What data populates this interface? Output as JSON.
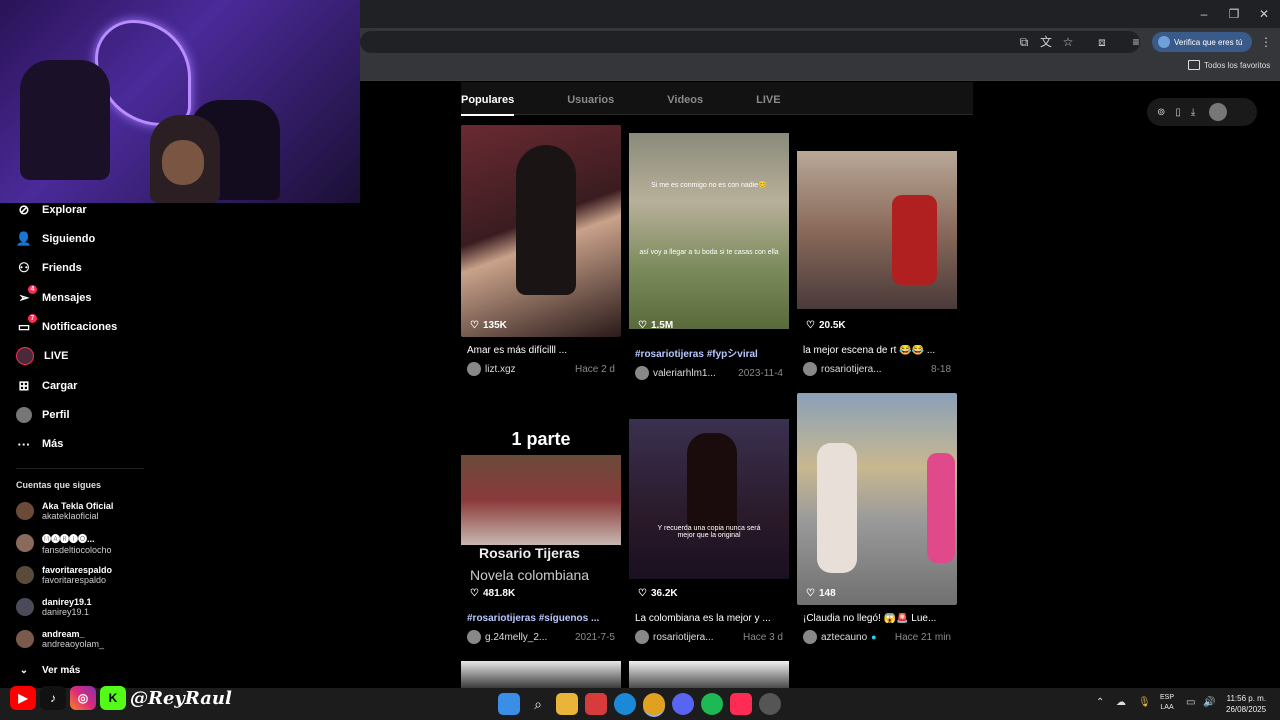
{
  "browser": {
    "verify_label": "Verifica que eres tú",
    "favorites_label": "Todos los favoritos"
  },
  "sidebar": {
    "items": [
      {
        "label": "Explorar",
        "icon": "compass-icon"
      },
      {
        "label": "Siguiendo",
        "icon": "following-icon"
      },
      {
        "label": "Friends",
        "icon": "friends-icon"
      },
      {
        "label": "Mensajes",
        "icon": "messages-icon",
        "badge": "4"
      },
      {
        "label": "Notificaciones",
        "icon": "notifications-icon",
        "badge": "7"
      },
      {
        "label": "LIVE",
        "icon": "live-icon"
      },
      {
        "label": "Cargar",
        "icon": "upload-icon"
      },
      {
        "label": "Perfil",
        "icon": "profile-icon"
      },
      {
        "label": "Más",
        "icon": "more-icon"
      }
    ],
    "following_title": "Cuentas que sigues",
    "accounts": [
      {
        "name": "Aka Tekla Oficial",
        "handle": "akateklaoficial"
      },
      {
        "name": "🅜🅐🅡🅘🅞...",
        "handle": "fansdeltiocolocho"
      },
      {
        "name": "favoritarespaldo",
        "handle": "favoritarespaldo"
      },
      {
        "name": "danirey19.1",
        "handle": "danirey19.1"
      },
      {
        "name": "andream_",
        "handle": "andreaoyolam_"
      }
    ],
    "see_more": "Ver más"
  },
  "tabs": [
    {
      "label": "Populares",
      "active": true
    },
    {
      "label": "Usuarios",
      "active": false
    },
    {
      "label": "Videos",
      "active": false
    },
    {
      "label": "LIVE",
      "active": false
    }
  ],
  "videos": [
    {
      "likes": "135K",
      "caption": "Amar es más difícilll ...",
      "user": "lizt.xgz",
      "date": "Hace 2 d"
    },
    {
      "likes": "1.5M",
      "caption": "#rosariotijeras #fypシviral",
      "user": "valeriarhlm1...",
      "date": "2023-11-4",
      "overlay1": "Si me es conmigo no es con nadie😊",
      "overlay2": "así voy a llegar a tu boda si te casas con ella"
    },
    {
      "likes": "20.5K",
      "caption": "la mejor escena de rt 😂😂 ...",
      "user": "rosariotijera...",
      "date": "8-18"
    },
    {
      "likes": "481.8K",
      "caption": "#rosariotijeras #síguenos ...",
      "user": "g.24melly_2...",
      "date": "2021-7-5",
      "title": "1 parte",
      "sub1": "Rosario  Tijeras",
      "sub2": "Novela colombiana"
    },
    {
      "likes": "36.2K",
      "caption": "La colombiana es la mejor y ...",
      "user": "rosariotijera...",
      "date": "Hace 3 d",
      "overlay1": "Y recuerda una copia nunca será mejor que la original"
    },
    {
      "likes": "148",
      "caption": "¡Claudia no llegó! 😱🚨 Lue...",
      "user": "aztecauno",
      "date": "Hace 21 min"
    }
  ],
  "stream": {
    "handle": "@ReyRaul"
  },
  "taskbar": {
    "lang1": "ESP",
    "lang2": "LAA",
    "time": "11:56 p. m.",
    "date": "26/08/2025"
  },
  "colors": {
    "accent": "#fe2c55",
    "background": "#000000"
  }
}
